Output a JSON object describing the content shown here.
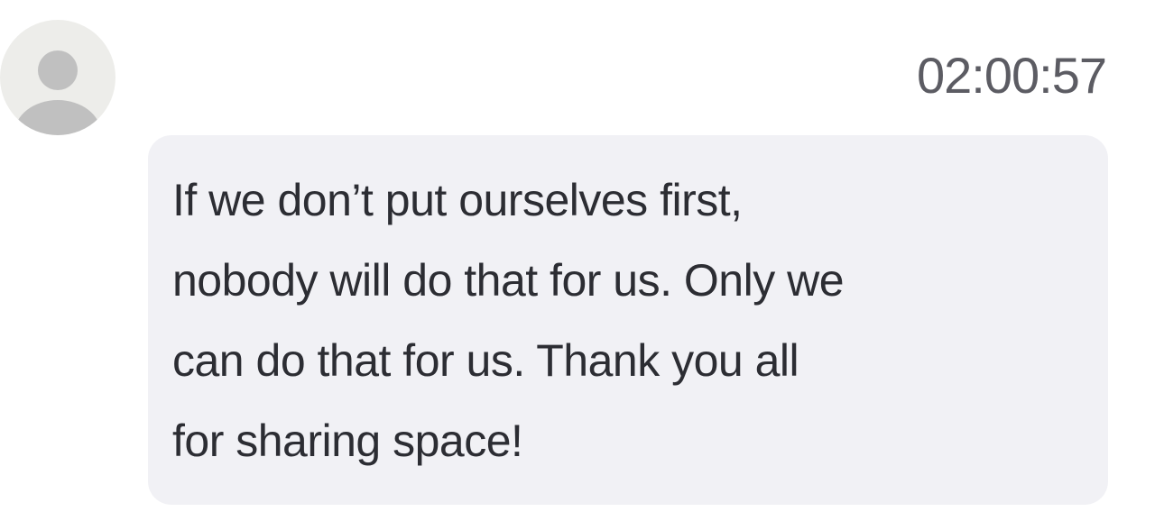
{
  "message": {
    "timestamp": "02:00:57",
    "text": "If we don’t put ourselves first,\nnobody will do that for us. Only we\ncan do that for us. Thank you all\nfor sharing space!"
  },
  "avatar": {
    "icon": "user-placeholder-icon",
    "background_color": "#ededea",
    "figure_color": "#c0c0c0"
  },
  "colors": {
    "bubble": "#f1f1f5",
    "text": "#2c2d33",
    "timestamp": "#5c5c63"
  }
}
